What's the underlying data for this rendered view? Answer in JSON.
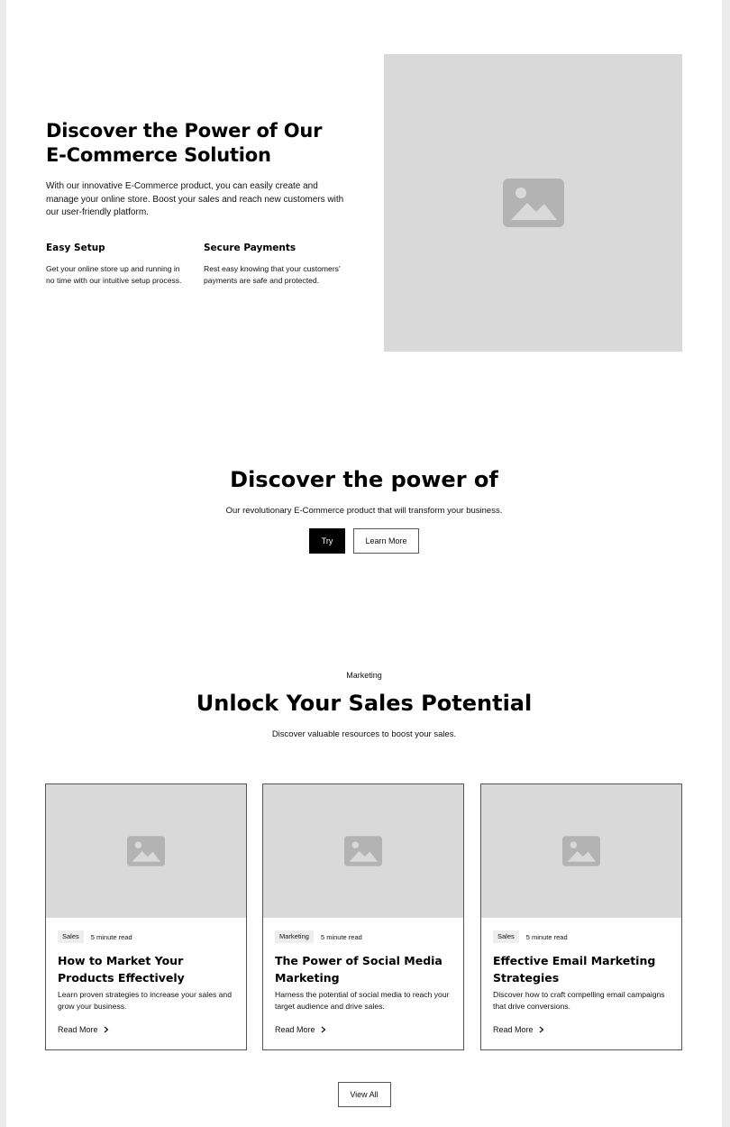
{
  "hero": {
    "title": "Discover the Power of Our E-Commerce Solution",
    "description": "With our innovative E-Commerce product, you can easily create and manage your online store. Boost your sales and reach new customers with our user-friendly platform.",
    "image_icon": "image-placeholder-icon",
    "features": [
      {
        "title": "Easy Setup",
        "description": "Get your online store up and running in no time with our intuitive setup process."
      },
      {
        "title": "Secure Payments",
        "description": "Rest easy knowing that your customers' payments are safe and protected."
      }
    ]
  },
  "cta": {
    "title": "Discover the power of",
    "description": "Our revolutionary E-Commerce product that will transform your business.",
    "primary_label": "Try",
    "secondary_label": "Learn More"
  },
  "blog": {
    "tagline": "Marketing",
    "title": "Unlock Your Sales Potential",
    "description": "Discover valuable resources to boost your sales.",
    "read_more_label": "Read More",
    "view_all_label": "View All",
    "posts": [
      {
        "tag": "Sales",
        "read_time": "5 minute read",
        "title": "How to Market Your Products Effectively",
        "description": "Learn proven strategies to increase your sales and grow your business."
      },
      {
        "tag": "Marketing",
        "read_time": "5 minute read",
        "title": "The Power of Social Media Marketing",
        "description": "Harness the potential of social media to reach your target audience and drive sales."
      },
      {
        "tag": "Sales",
        "read_time": "5 minute read",
        "title": "Effective Email Marketing Strategies",
        "description": "Discover how to craft compelling email campaigns that drive conversions."
      }
    ]
  },
  "colors": {
    "placeholder": "#d9d9d9",
    "placeholder_icon": "#b3b3b3",
    "primary": "#000000",
    "background": "#ffffff",
    "page_frame": "#ececec"
  }
}
